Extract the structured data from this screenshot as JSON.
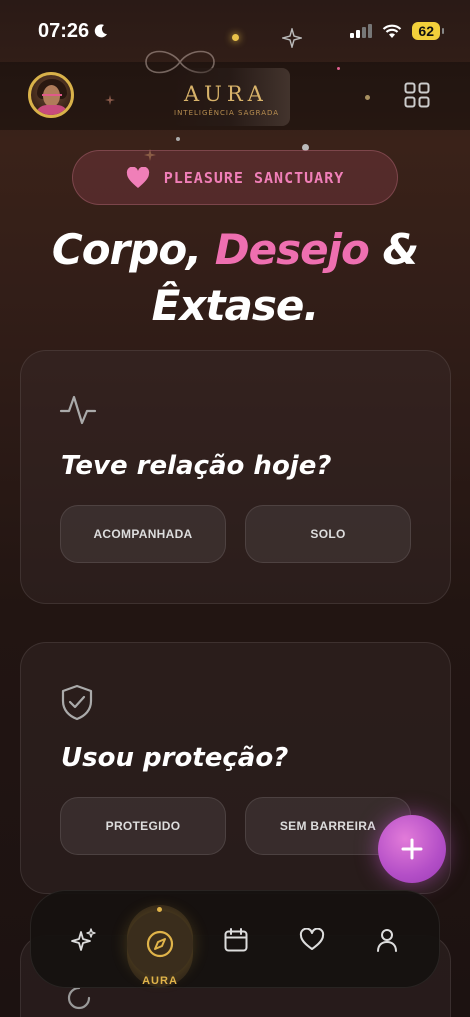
{
  "status": {
    "time": "07:26",
    "battery": "62"
  },
  "header": {
    "logo": "AURA",
    "logo_subtitle": "INTELIGÊNCIA SAGRADA"
  },
  "badge": {
    "label": "PLEASURE SANCTUARY",
    "icon": "heart-icon"
  },
  "headline": {
    "part1": "Corpo, ",
    "highlight": "Desejo",
    "part2": " &",
    "line2": "Êxtase."
  },
  "cards": [
    {
      "icon": "pulse-icon",
      "question": "Teve relação hoje?",
      "options": [
        "ACOMPANHADA",
        "SOLO"
      ]
    },
    {
      "icon": "shield-check-icon",
      "question": "Usou proteção?",
      "options": [
        "PROTEGIDO",
        "SEM BARREIRA"
      ]
    }
  ],
  "nav": {
    "items": [
      {
        "icon": "sparkles-icon"
      },
      {
        "icon": "compass-icon",
        "label": "AURA",
        "active": true
      },
      {
        "icon": "calendar-icon"
      },
      {
        "icon": "heart-outline-icon"
      },
      {
        "icon": "user-icon"
      }
    ]
  },
  "colors": {
    "accent_pink": "#ee6fb0",
    "accent_gold": "#e0b44a",
    "fab": "#b44fc7"
  }
}
